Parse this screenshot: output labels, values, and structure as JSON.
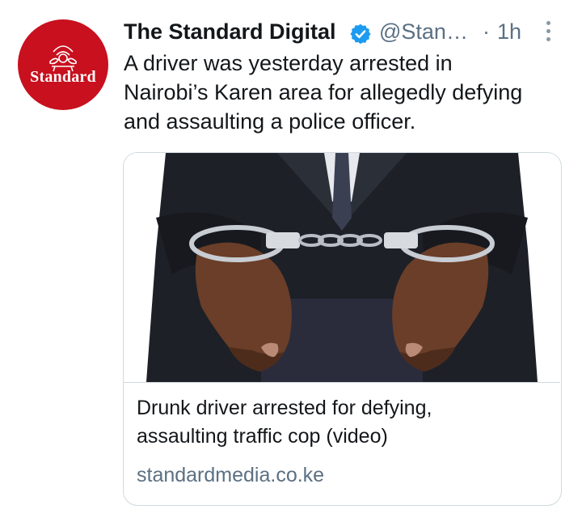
{
  "tweet": {
    "author_name": "The Standard Digital",
    "handle": "@Stan…",
    "separator": "·",
    "time": "1h",
    "text_lines": [
      "A driver was yesterday arrested in",
      "Nairobi’s Karen area for allegedly defying",
      "and assaulting a police officer."
    ],
    "avatar": {
      "brand_text": "Standard",
      "icon": "standard-crest-logo"
    },
    "verified_icon": "verified-badge-icon",
    "more_icon": "more-vertical-icon"
  },
  "card": {
    "image": "handcuffed-hands-photo",
    "title_lines": [
      "Drunk driver arrested for defying,",
      "assaulting traffic cop (video)"
    ],
    "domain": "standardmedia.co.ke"
  },
  "colors": {
    "brand_red": "#c8101e",
    "verified_blue": "#1d9bf0",
    "secondary_text": "#5b7083",
    "border": "#cfd9de"
  }
}
